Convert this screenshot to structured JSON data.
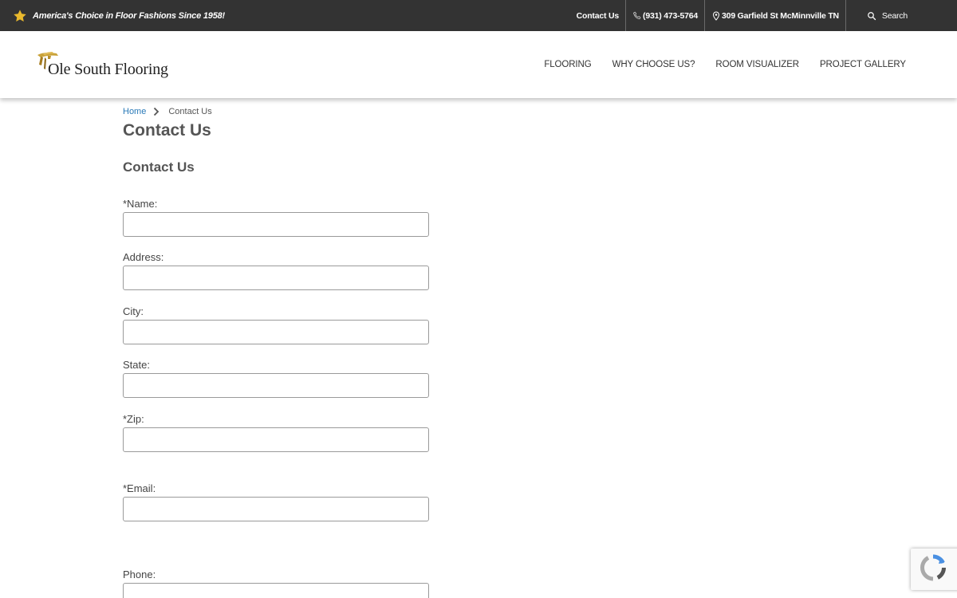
{
  "topbar": {
    "tagline": "America's Choice in Floor Fashions Since 1958!",
    "contact": "Contact Us",
    "phone": "(931) 473-5764",
    "address": "309 Garfield St McMinnville TN",
    "search": "Search"
  },
  "header": {
    "logo_text": "Ole South Flooring",
    "nav": [
      "FLOORING",
      "WHY CHOOSE US?",
      "ROOM VISUALIZER",
      "PROJECT GALLERY"
    ]
  },
  "breadcrumb": {
    "home": "Home",
    "current": "Contact Us"
  },
  "page_title": "Contact Us",
  "form": {
    "title": "Contact Us",
    "fields": [
      {
        "label": "*Name:",
        "value": ""
      },
      {
        "label": "Address:",
        "value": ""
      },
      {
        "label": "City:",
        "value": ""
      },
      {
        "label": "State:",
        "value": ""
      },
      {
        "label": "*Zip:",
        "value": ""
      },
      {
        "label": "*Email:",
        "value": ""
      },
      {
        "label": "Phone:",
        "value": ""
      }
    ]
  },
  "colors": {
    "topbar": "#333333",
    "accent_star": "#e9b92d",
    "link": "#2a7ab8"
  }
}
